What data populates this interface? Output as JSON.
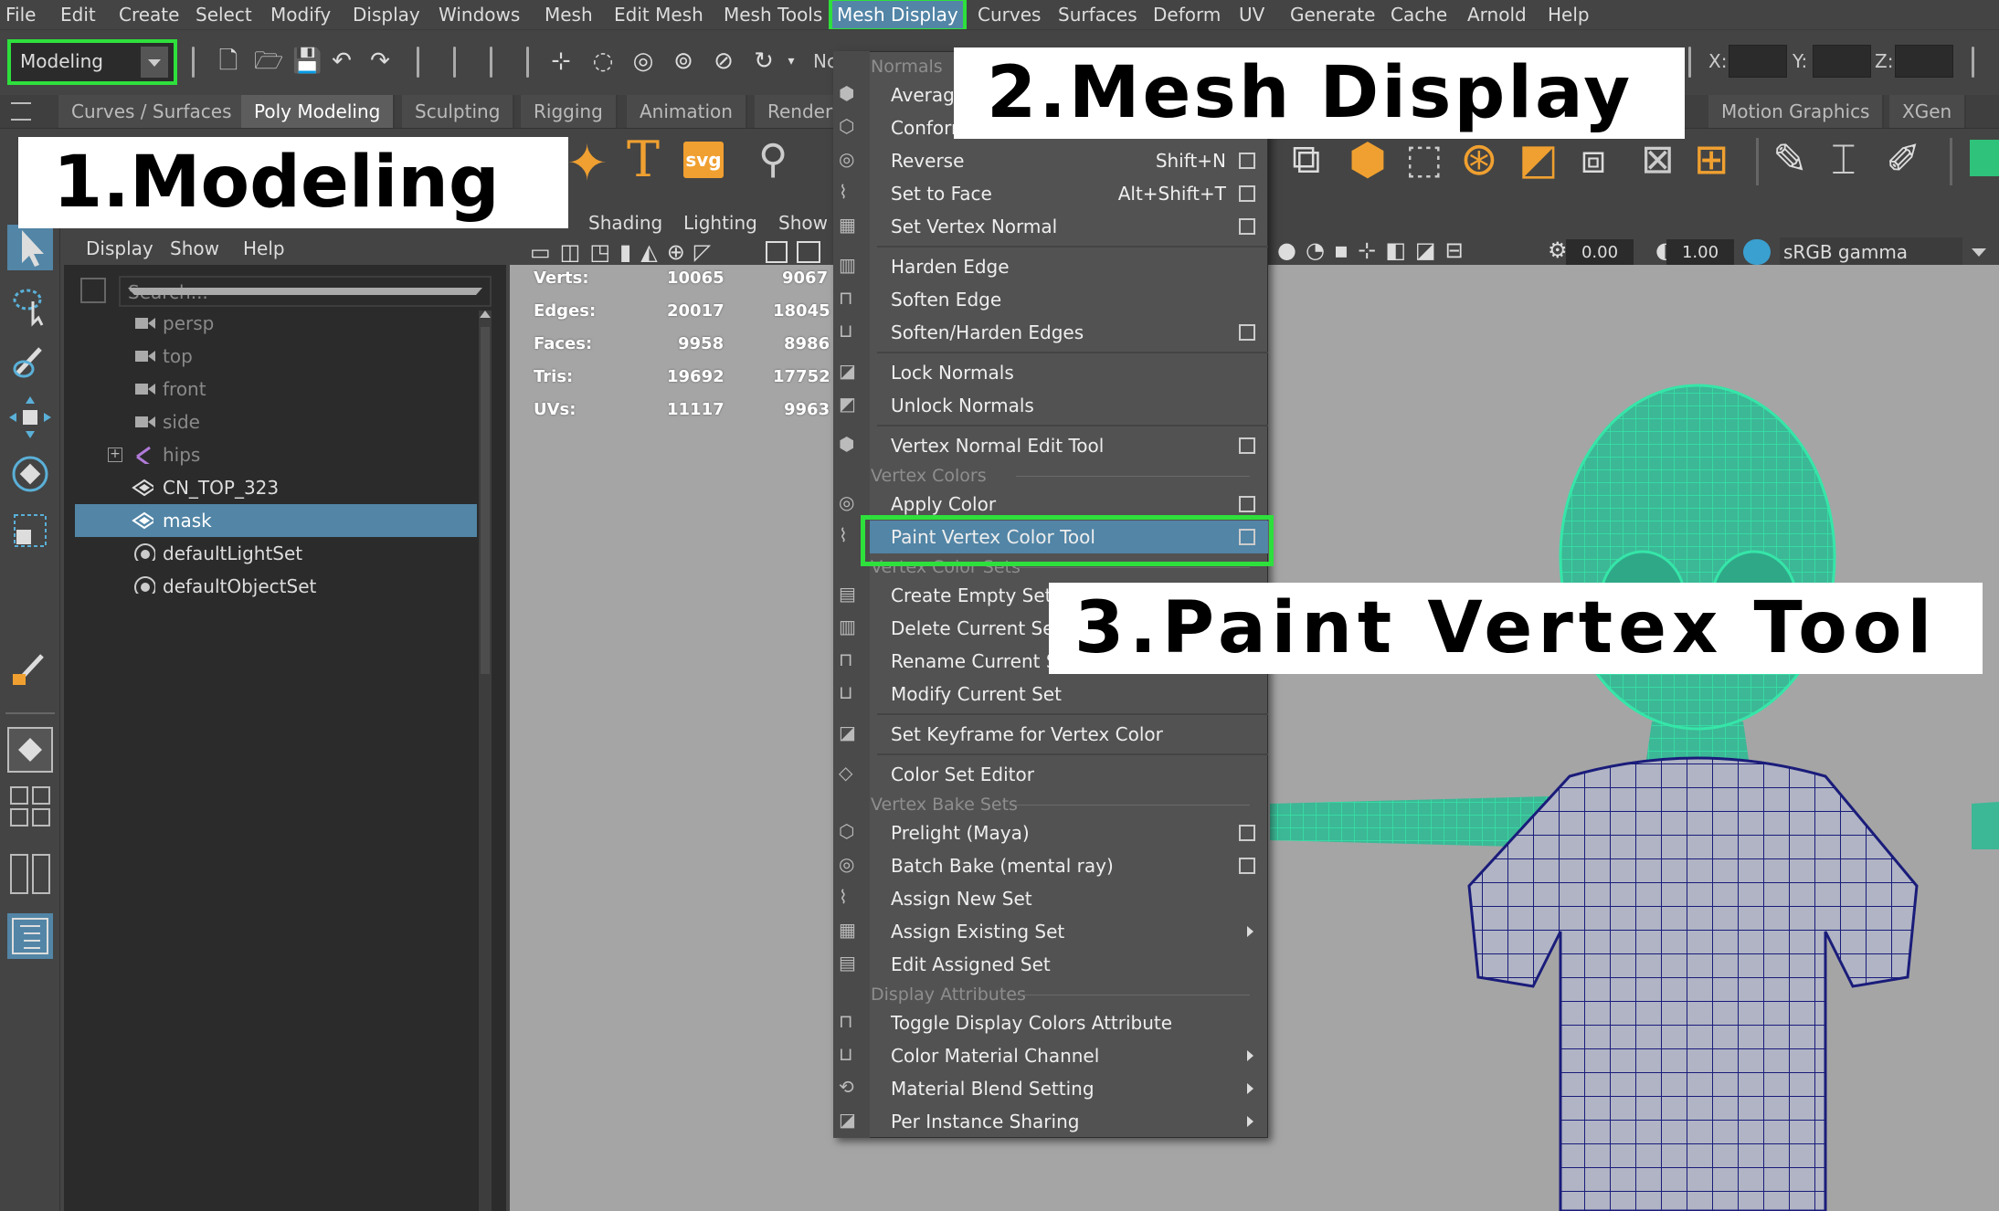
{
  "menubar": {
    "items": [
      "File",
      "Edit",
      "Create",
      "Select",
      "Modify",
      "Display",
      "Windows",
      "Mesh",
      "Edit Mesh",
      "Mesh Tools",
      "Mesh Display",
      "Curves",
      "Surfaces",
      "Deform",
      "UV",
      "Generate",
      "Cache",
      "Arnold",
      "Help"
    ],
    "active": "Mesh Display"
  },
  "toolbar": {
    "mode_value": "Modeling",
    "clipped_label": "Nc",
    "coord_labels": [
      "X:",
      "Y:",
      "Z:"
    ]
  },
  "shelf": {
    "tabs": [
      "Curves / Surfaces",
      "Poly Modeling",
      "Sculpting",
      "Rigging",
      "Animation",
      "Renderi",
      "Motion Graphics",
      "XGen"
    ],
    "active_tab": "Poly Modeling",
    "svg_label": "svg",
    "text_tool_label": "T"
  },
  "outliner": {
    "menus": [
      "Display",
      "Show",
      "Help"
    ],
    "search_placeholder": "Search...",
    "items": [
      {
        "label": "persp",
        "type": "camera",
        "dim": true
      },
      {
        "label": "top",
        "type": "camera",
        "dim": true
      },
      {
        "label": "front",
        "type": "camera",
        "dim": true
      },
      {
        "label": "side",
        "type": "camera",
        "dim": true
      },
      {
        "label": "hips",
        "type": "joint",
        "dim": true,
        "expandable": true
      },
      {
        "label": "CN_TOP_323",
        "type": "mesh",
        "dim": false
      },
      {
        "label": "mask",
        "type": "mesh",
        "dim": false,
        "selected": true
      },
      {
        "label": "defaultLightSet",
        "type": "set",
        "dim": false
      },
      {
        "label": "defaultObjectSet",
        "type": "set",
        "dim": false
      }
    ]
  },
  "viewport": {
    "menus": [
      "Shading",
      "Lighting",
      "Show"
    ],
    "hud": [
      {
        "label": "Verts:",
        "a": "10065",
        "b": "9067"
      },
      {
        "label": "Edges:",
        "a": "20017",
        "b": "18045"
      },
      {
        "label": "Faces:",
        "a": "9958",
        "b": "8986"
      },
      {
        "label": "Tris:",
        "a": "19692",
        "b": "17752"
      },
      {
        "label": "UVs:",
        "a": "11117",
        "b": "9963"
      }
    ],
    "exposure": "0.00",
    "gamma": "1.00",
    "color_space": "sRGB gamma"
  },
  "mesh_display_menu": {
    "entries": [
      {
        "kind": "section",
        "label": "Normals"
      },
      {
        "kind": "item",
        "label": "Average Normals"
      },
      {
        "kind": "item",
        "label": "Conform"
      },
      {
        "kind": "item",
        "label": "Reverse",
        "shortcut": "Shift+N",
        "option_box": true
      },
      {
        "kind": "item",
        "label": "Set to Face",
        "shortcut": "Alt+Shift+T",
        "option_box": true
      },
      {
        "kind": "item",
        "label": "Set Vertex Normal",
        "option_box": true
      },
      {
        "kind": "sep"
      },
      {
        "kind": "item",
        "label": "Harden Edge"
      },
      {
        "kind": "item",
        "label": "Soften Edge"
      },
      {
        "kind": "item",
        "label": "Soften/Harden Edges",
        "option_box": true
      },
      {
        "kind": "sep"
      },
      {
        "kind": "item",
        "label": "Lock Normals"
      },
      {
        "kind": "item",
        "label": "Unlock Normals"
      },
      {
        "kind": "sep"
      },
      {
        "kind": "item",
        "label": "Vertex Normal Edit Tool",
        "option_box": true
      },
      {
        "kind": "section",
        "label": "Vertex Colors"
      },
      {
        "kind": "item",
        "label": "Apply Color",
        "option_box": true
      },
      {
        "kind": "item",
        "label": "Paint Vertex Color Tool",
        "option_box": true,
        "highlighted": true
      },
      {
        "kind": "section",
        "label": "Vertex Color Sets"
      },
      {
        "kind": "item",
        "label": "Create Empty Set"
      },
      {
        "kind": "item",
        "label": "Delete Current Set"
      },
      {
        "kind": "item",
        "label": "Rename Current Set"
      },
      {
        "kind": "item",
        "label": "Modify Current Set"
      },
      {
        "kind": "sep"
      },
      {
        "kind": "item",
        "label": "Set Keyframe for Vertex Color"
      },
      {
        "kind": "sep"
      },
      {
        "kind": "item",
        "label": "Color Set Editor"
      },
      {
        "kind": "section",
        "label": "Vertex Bake Sets"
      },
      {
        "kind": "item",
        "label": "Prelight (Maya)",
        "option_box": true
      },
      {
        "kind": "item",
        "label": "Batch Bake (mental ray)",
        "option_box": true
      },
      {
        "kind": "item",
        "label": "Assign New Set"
      },
      {
        "kind": "item",
        "label": "Assign Existing Set",
        "submenu": true
      },
      {
        "kind": "item",
        "label": "Edit Assigned Set"
      },
      {
        "kind": "section",
        "label": "Display Attributes"
      },
      {
        "kind": "item",
        "label": "Toggle Display Colors Attribute"
      },
      {
        "kind": "item",
        "label": "Color Material Channel",
        "submenu": true
      },
      {
        "kind": "item",
        "label": "Material Blend Setting",
        "submenu": true
      },
      {
        "kind": "item",
        "label": "Per Instance Sharing",
        "submenu": true
      }
    ]
  },
  "callouts": {
    "step1": "1.Modeling",
    "step2": "2.Mesh Display",
    "step3": "3.Paint Vertex Tool"
  },
  "colors": {
    "highlight_green": "#2ee03c",
    "selection_blue": "#5285a6",
    "wireframe": "#35e6a8",
    "mesh_wire": "#1a1c7a"
  }
}
